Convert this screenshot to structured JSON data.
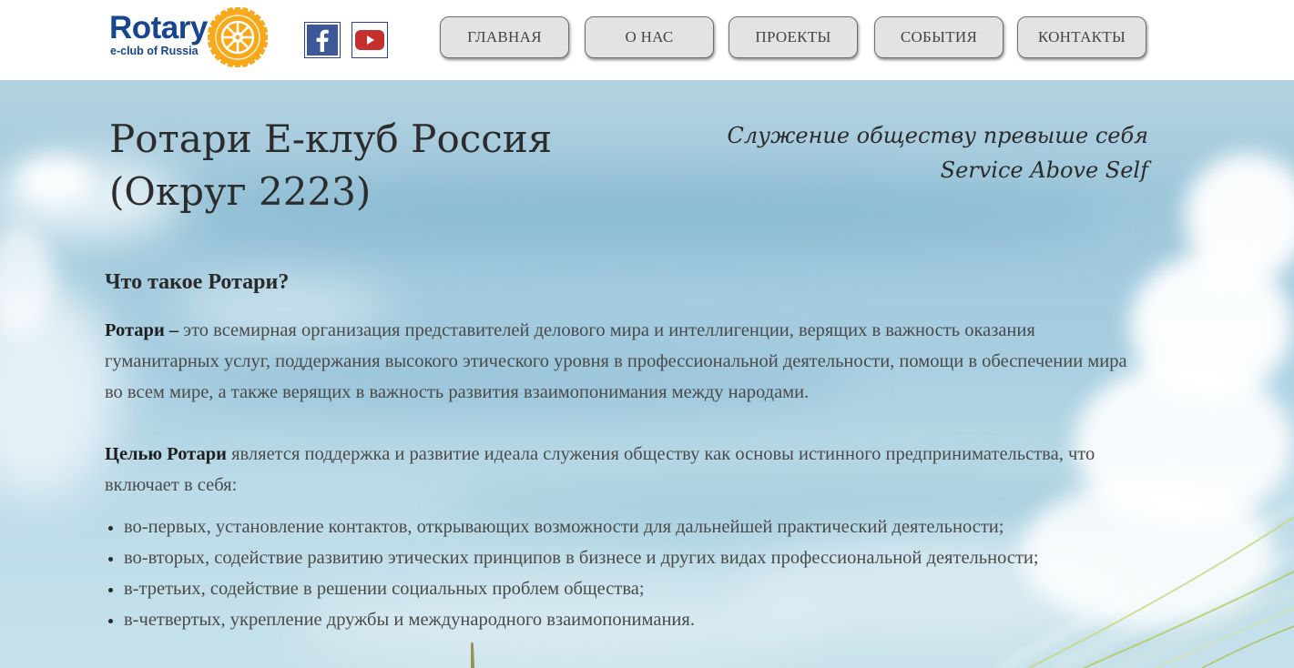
{
  "header": {
    "logo_word": "Rotary",
    "logo_sub": "e-club of Russia",
    "social": [
      {
        "name": "facebook",
        "icon": "facebook-icon",
        "color": "#3b5998"
      },
      {
        "name": "youtube",
        "icon": "youtube-icon",
        "color": "#c4302b"
      }
    ],
    "nav": [
      "ГЛАВНАЯ",
      "О НАС",
      "ПРОЕКТЫ",
      "СОБЫТИЯ",
      "КОНТАКТЫ"
    ]
  },
  "hero": {
    "title_line1": "Ротари Е-клуб Россия",
    "title_line2": "(Округ 2223)",
    "motto_ru": "Служение обществу превыше себя",
    "motto_en": "Service Above Self"
  },
  "content": {
    "question": "Что такое Ротари?",
    "p1_bold": "Ротари –",
    "p1_text": " это всемирная организация представителей делового мира и интеллигенции, верящих в важность оказания гуманитарных услуг, поддержания высокого этического уровня в профессиональной деятельности, помощи в обеспечении мира во всем мире, а также верящих в важность развития взаимопонимания между народами.",
    "p2_bold": "Целью Ротари",
    "p2_text": " является поддержка и развитие идеала служения обществу как основы истинного предпринимательства, что включает в себя:",
    "goals": [
      "во-первых, установление контактов, открывающих возможности для дальнейшей практический деятельности;",
      "во-вторых, содействие развитию этических принципов в бизнесе и других видах профессиональной деятельности;",
      "в-третьих, содействие в решении социальных проблем общества;",
      "в-четвертых, укрепление дружбы и международного взаимопонимания."
    ]
  },
  "colors": {
    "brand_blue": "#17458f",
    "brand_gold": "#f7a81b",
    "nav_bg": "#e3e3e3",
    "sky": "#a6cde0"
  }
}
